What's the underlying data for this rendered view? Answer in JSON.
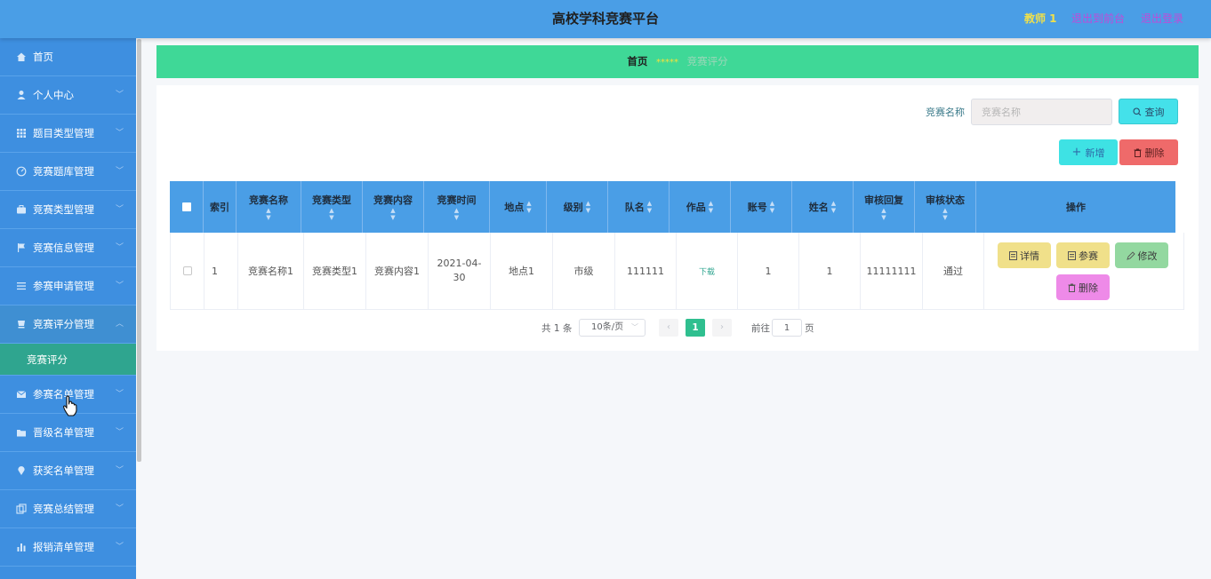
{
  "header": {
    "title": "高校学科竞赛平台",
    "user": "教师 1",
    "back_to_front": "退出到前台",
    "logout": "退出登录"
  },
  "sidebar": {
    "items": [
      {
        "label": "首页",
        "icon": "home-icon",
        "chevron": false
      },
      {
        "label": "个人中心",
        "icon": "user-icon",
        "chevron": true
      },
      {
        "label": "题目类型管理",
        "icon": "grid-icon",
        "chevron": true
      },
      {
        "label": "竞赛题库管理",
        "icon": "gauge-icon",
        "chevron": true
      },
      {
        "label": "竞赛类型管理",
        "icon": "briefcase-icon",
        "chevron": true
      },
      {
        "label": "竞赛信息管理",
        "icon": "flag-icon",
        "chevron": true
      },
      {
        "label": "参赛申请管理",
        "icon": "list-icon",
        "chevron": true
      },
      {
        "label": "竞赛评分管理",
        "icon": "cup-icon",
        "chevron": true,
        "expanded": true
      },
      {
        "label": "参赛名单管理",
        "icon": "mail-icon",
        "chevron": true
      },
      {
        "label": "晋级名单管理",
        "icon": "folder-icon",
        "chevron": true
      },
      {
        "label": "获奖名单管理",
        "icon": "location-icon",
        "chevron": true
      },
      {
        "label": "竞赛总结管理",
        "icon": "copy-icon",
        "chevron": true
      },
      {
        "label": "报销清单管理",
        "icon": "bar-chart-icon",
        "chevron": true
      }
    ],
    "sub_item": "竞赛评分"
  },
  "breadcrumb": {
    "home": "首页",
    "separator": "*****",
    "current": "竞赛评分"
  },
  "search": {
    "label": "竞赛名称",
    "placeholder": "竞赛名称",
    "query_button": "查询"
  },
  "actions": {
    "add_button": "新增",
    "delete_button": "删除"
  },
  "table": {
    "columns": [
      "索引",
      "竞赛名称",
      "竞赛类型",
      "竞赛内容",
      "竞赛时间",
      "地点",
      "级别",
      "队名",
      "作品",
      "账号",
      "姓名",
      "审核回复",
      "审核状态",
      "操作"
    ],
    "rows": [
      {
        "index": "1",
        "name": "竞赛名称1",
        "type": "竞赛类型1",
        "content": "竞赛内容1",
        "time": "2021-04-30",
        "location": "地点1",
        "level": "市级",
        "team": "111111",
        "work": "下载",
        "account": "1",
        "realname": "1",
        "review_reply": "11111111",
        "review_status": "通过"
      }
    ],
    "ops": {
      "detail": "详情",
      "join": "参赛",
      "edit": "修改",
      "delete": "删除"
    }
  },
  "pagination": {
    "total": "共 1 条",
    "page_size": "10条/页",
    "current_page": "1",
    "goto_label": "前往",
    "goto_value": "1",
    "page_suffix": "页"
  },
  "colors": {
    "header": "#4a9ee6",
    "sidebar": "#3e8fe0",
    "breadcrumb": "#3fd897",
    "sub_active": "#2fa58f",
    "op_detail": "#f0e08a",
    "op_edit": "#93d8a0",
    "op_delete": "#ee8ae8"
  }
}
